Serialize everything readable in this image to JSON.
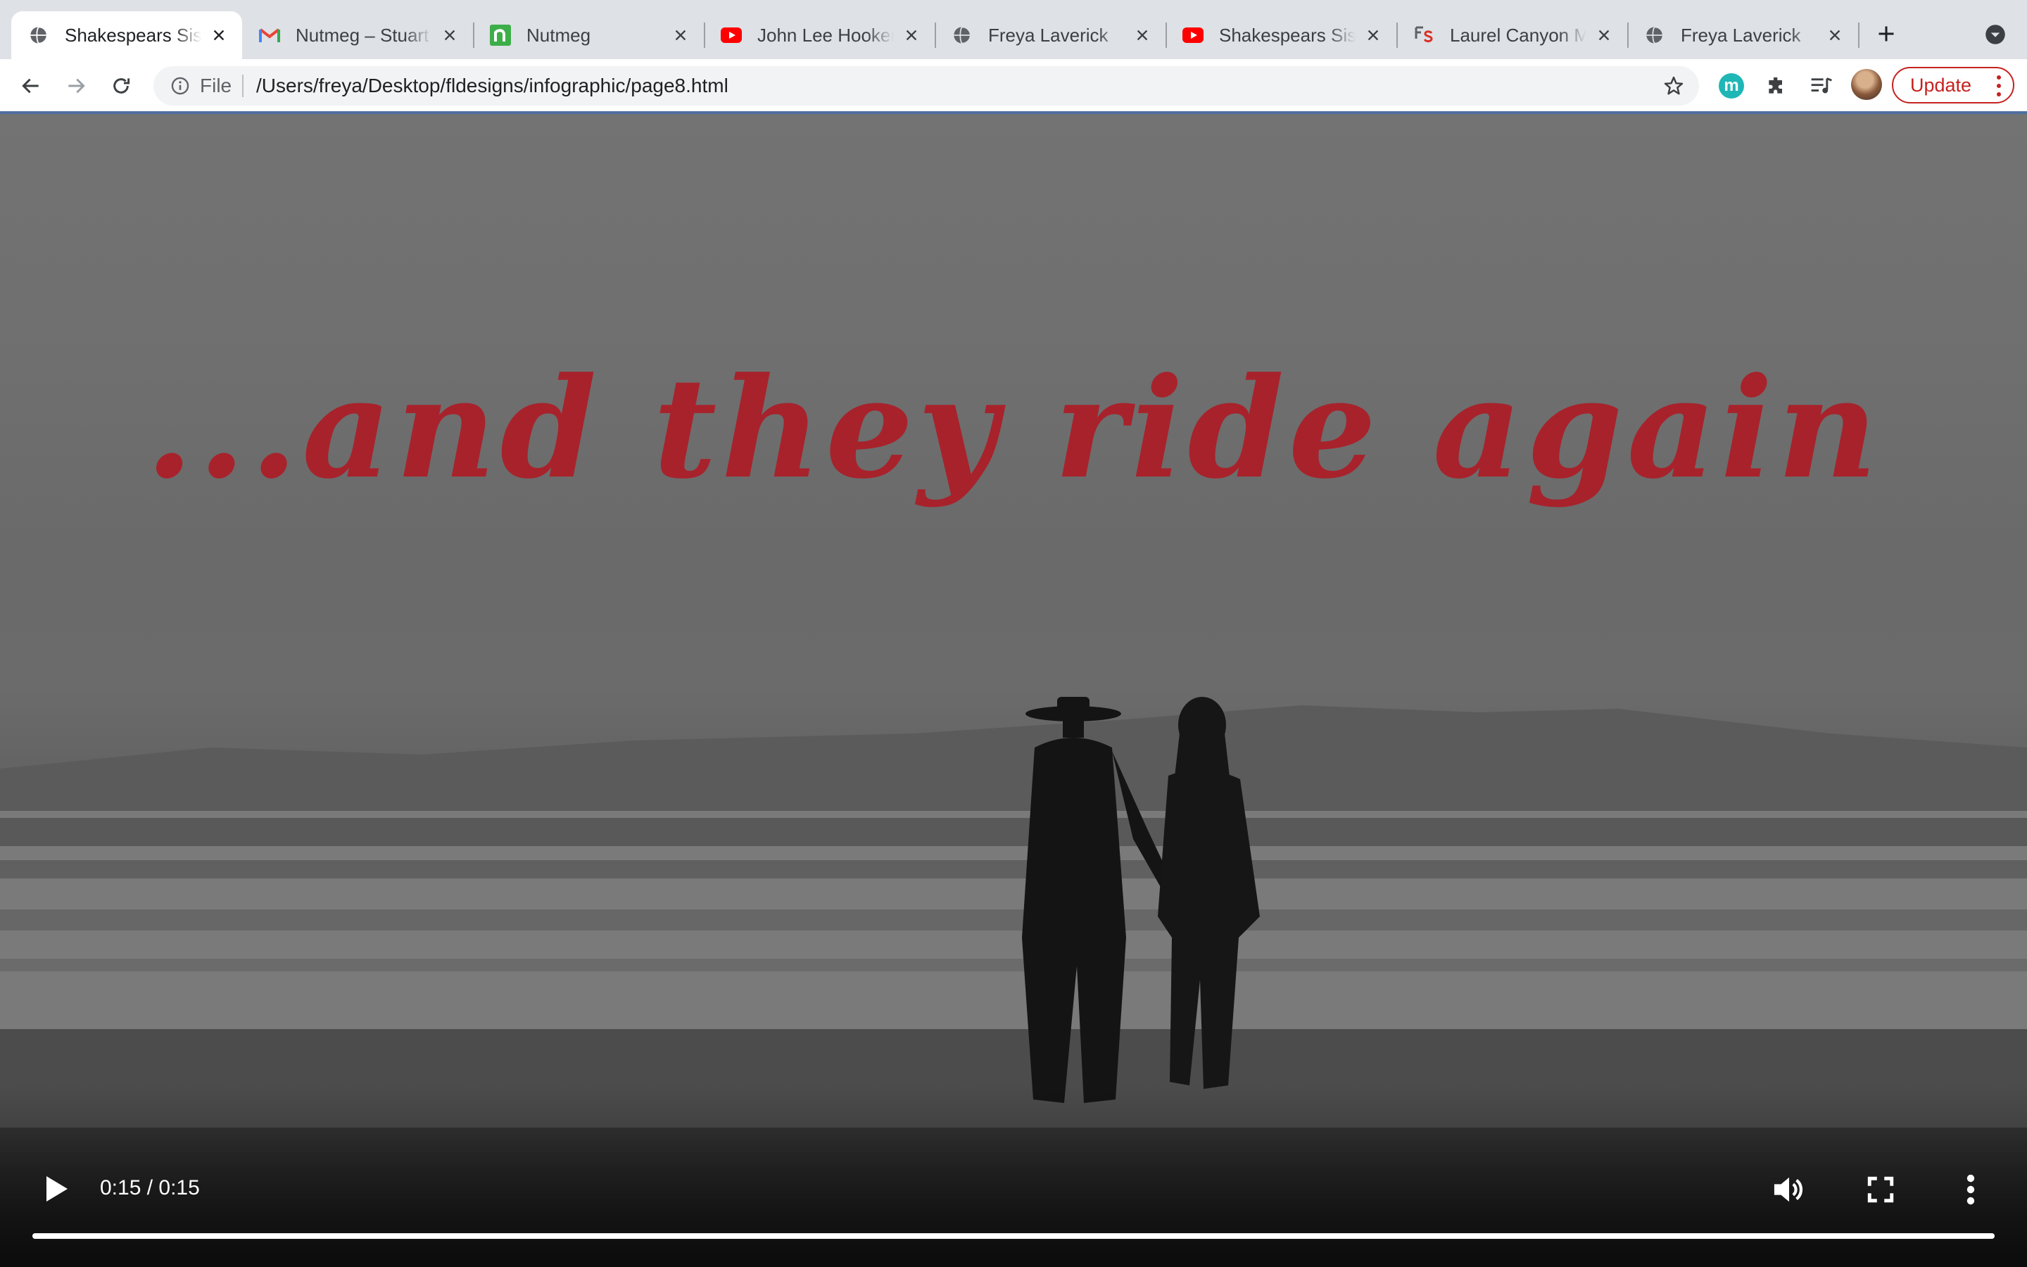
{
  "tabs": [
    {
      "title": "Shakespears Sister",
      "favicon": "globe-icon",
      "active": true
    },
    {
      "title": "Nutmeg – Stuart m",
      "favicon": "gmail-icon",
      "active": false
    },
    {
      "title": "Nutmeg",
      "favicon": "nutmeg-icon",
      "active": false
    },
    {
      "title": "John Lee Hooker",
      "favicon": "youtube-icon",
      "active": false
    },
    {
      "title": "Freya Laverick",
      "favicon": "globe-icon",
      "active": false
    },
    {
      "title": "Shakespears Sister",
      "favicon": "youtube-icon",
      "active": false
    },
    {
      "title": "Laurel Canyon Ma",
      "favicon": "fs-icon",
      "active": false
    },
    {
      "title": "Freya Laverick",
      "favicon": "globe-icon",
      "active": false
    }
  ],
  "omnibox": {
    "scheme": "File",
    "url": "/Users/freya/Desktop/fldesigns/infographic/page8.html"
  },
  "extensions": {
    "m_label": "m"
  },
  "update_label": "Update",
  "video": {
    "overlay_text": "...and they ride again",
    "overlay_color": "#a8222b",
    "time": "0:15 / 0:15",
    "progress": 1.0
  },
  "colors": {
    "tabstrip": "#dee1e6",
    "toolbar": "#ffffff",
    "update_red": "#c5221f",
    "ext_teal": "#1fb6b6"
  }
}
